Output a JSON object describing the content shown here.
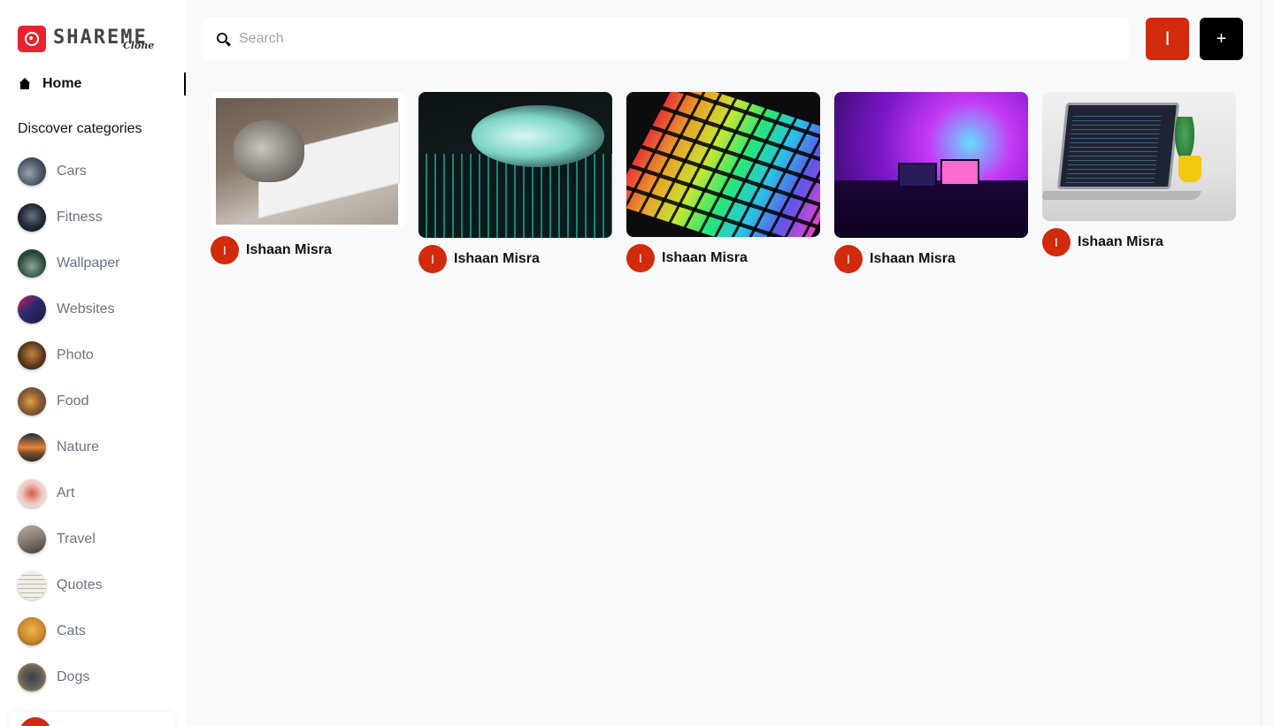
{
  "brand": {
    "name": "SHAREME",
    "sub": "Clone"
  },
  "nav": {
    "home_label": "Home"
  },
  "sidebar": {
    "section_title": "Discover categories",
    "categories": [
      {
        "label": "Cars",
        "color": "#4b5563"
      },
      {
        "label": "Fitness",
        "color": "#1f2937"
      },
      {
        "label": "Wallpaper",
        "color": "#2f4f3f"
      },
      {
        "label": "Websites",
        "color": "#2b2a6e"
      },
      {
        "label": "Photo",
        "color": "#5a3a1e"
      },
      {
        "label": "Food",
        "color": "#8a5a2e"
      },
      {
        "label": "Nature",
        "color": "#7a4a2a"
      },
      {
        "label": "Art",
        "color": "#d35a4a"
      },
      {
        "label": "Travel",
        "color": "#8b8178"
      },
      {
        "label": "Quotes",
        "color": "#e8e4da"
      },
      {
        "label": "Cats",
        "color": "#c98a2e"
      },
      {
        "label": "Dogs",
        "color": "#6b6250"
      }
    ]
  },
  "search": {
    "placeholder": "Search",
    "value": ""
  },
  "header": {
    "user_initial": "I",
    "add_label": "+"
  },
  "pins": [
    {
      "author": "Ishaan Misra",
      "initial": "I"
    },
    {
      "author": "Ishaan Misra",
      "initial": "I"
    },
    {
      "author": "Ishaan Misra",
      "initial": "I"
    },
    {
      "author": "Ishaan Misra",
      "initial": "I"
    },
    {
      "author": "Ishaan Misra",
      "initial": "I"
    }
  ],
  "colors": {
    "accent": "#d12a0c",
    "brand_red": "#e8232f",
    "muted_text": "#6b7280"
  }
}
